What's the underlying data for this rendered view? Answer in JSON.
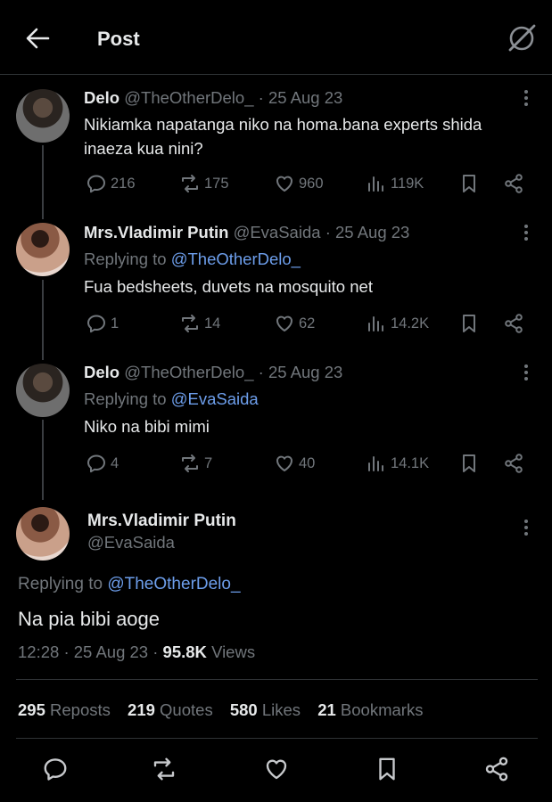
{
  "header": {
    "title": "Post",
    "back_icon": "back-arrow-icon",
    "grok_icon": "grok-icon"
  },
  "tweets": [
    {
      "name": "Delo",
      "handle": "@TheOtherDelo_",
      "sep": "·",
      "date": "25 Aug 23",
      "replying_prefix": "",
      "replying_to": "",
      "text": "Nikiamka napatanga niko na homa.bana experts shida inaeza kua nini?",
      "replies": "216",
      "reposts": "175",
      "likes": "960",
      "views": "119K"
    },
    {
      "name": "Mrs.Vladimir Putin",
      "handle": "@EvaSaida",
      "sep": "·",
      "date": "25 Aug 23",
      "replying_prefix": "Replying to",
      "replying_to": "@TheOtherDelo_",
      "text": "Fua bedsheets, duvets na mosquito net",
      "replies": "1",
      "reposts": "14",
      "likes": "62",
      "views": "14.2K"
    },
    {
      "name": "Delo",
      "handle": "@TheOtherDelo_",
      "sep": "·",
      "date": "25 Aug 23",
      "replying_prefix": "Replying to",
      "replying_to": "@EvaSaida",
      "text": "Niko na bibi mimi",
      "replies": "4",
      "reposts": "7",
      "likes": "40",
      "views": "14.1K"
    }
  ],
  "main_tweet": {
    "name": "Mrs.Vladimir Putin",
    "handle": "@EvaSaida",
    "replying_prefix": "Replying to",
    "replying_to": "@TheOtherDelo_",
    "text": "Na pia bibi aoge",
    "time": "12:28",
    "date": "25 Aug 23",
    "sep": "·",
    "views_count": "95.8K",
    "views_label": "Views",
    "stats": [
      {
        "count": "295",
        "label": "Reposts"
      },
      {
        "count": "219",
        "label": "Quotes"
      },
      {
        "count": "580",
        "label": "Likes"
      },
      {
        "count": "21",
        "label": "Bookmarks"
      }
    ]
  },
  "colors": {
    "background": "#000000",
    "text": "#e7e9ea",
    "muted": "#71767b",
    "link": "#6d9eeb",
    "border": "#2f3336"
  }
}
